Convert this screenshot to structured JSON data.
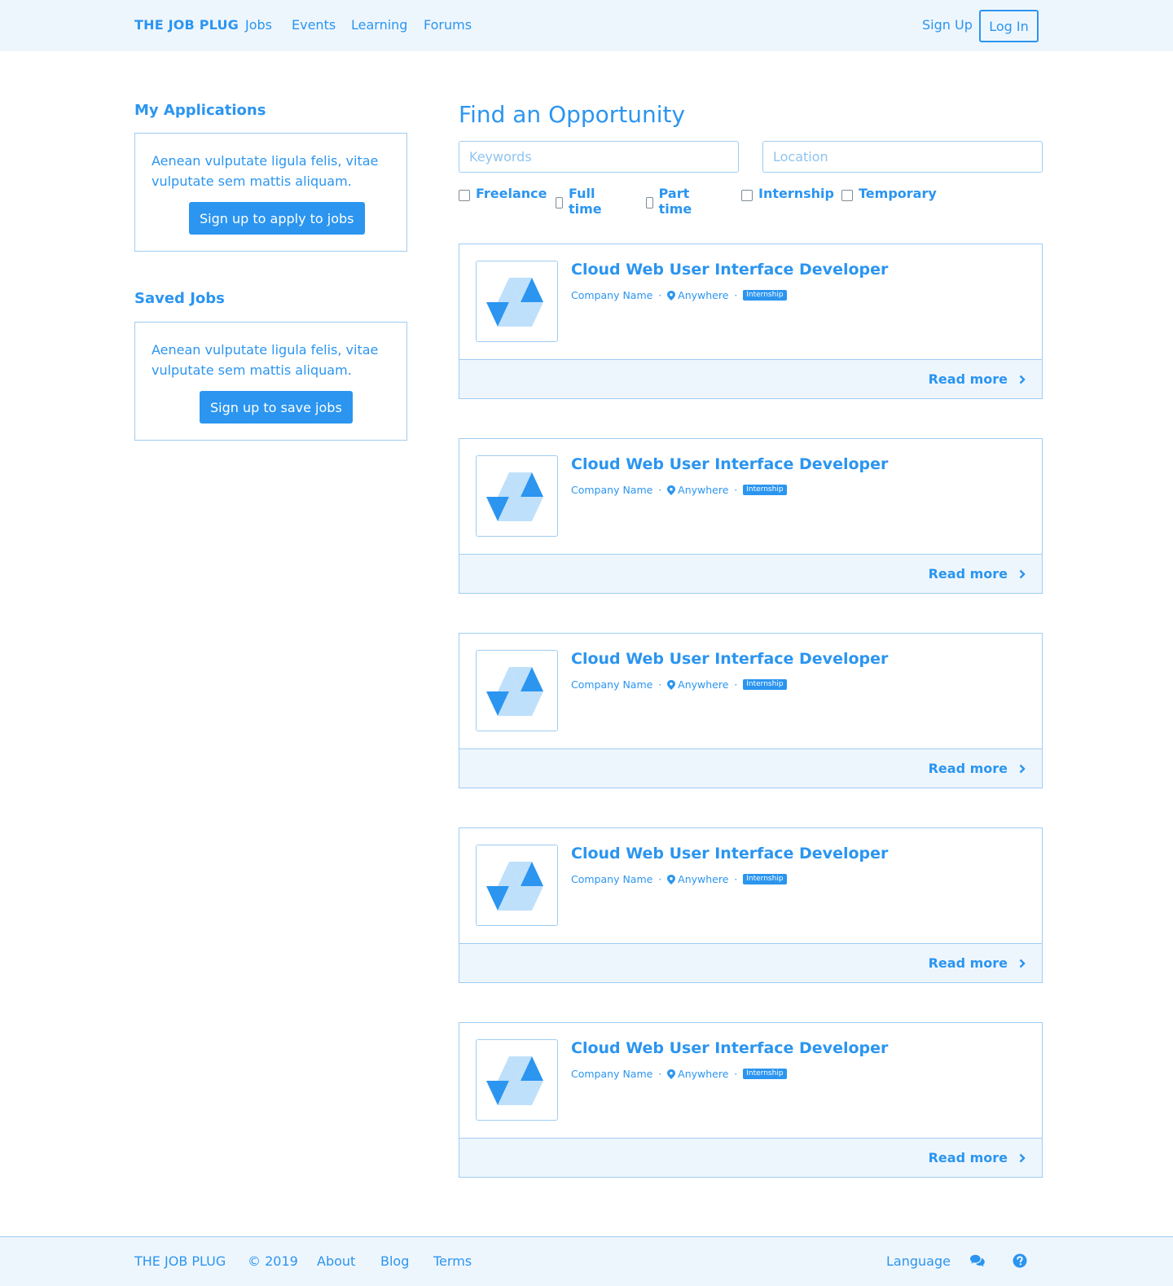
{
  "nav": {
    "brand": "THE JOB PLUG",
    "links": [
      "Jobs",
      "Events",
      "Learning",
      "Forums"
    ],
    "signup": "Sign Up",
    "login": "Log In"
  },
  "sidebar": {
    "applications": {
      "title": "My Applications",
      "text": "Aenean vulputate ligula felis, vitae vulputate sem mattis aliquam.",
      "button": "Sign up to apply to jobs"
    },
    "saved": {
      "title": "Saved Jobs",
      "text": "Aenean vulputate ligula felis, vitae vulputate sem mattis aliquam.",
      "button": "Sign up to save jobs"
    }
  },
  "main": {
    "title": "Find an Opportunity",
    "search": {
      "keywords_placeholder": "Keywords",
      "keywords_value": "",
      "location_placeholder": "Location",
      "location_value": ""
    },
    "filters": [
      {
        "label": "Freelance",
        "checked": false
      },
      {
        "label": "Full time",
        "checked": false
      },
      {
        "label": "Part time",
        "checked": false
      },
      {
        "label": "Internship",
        "checked": false
      },
      {
        "label": "Temporary",
        "checked": false
      }
    ],
    "jobs": [
      {
        "title": "Cloud Web User Interface Developer",
        "company": "Company Name",
        "location": "Anywhere",
        "type": "Internship",
        "link": "Read more"
      },
      {
        "title": "Cloud Web User Interface Developer",
        "company": "Company Name",
        "location": "Anywhere",
        "type": "Internship",
        "link": "Read more"
      },
      {
        "title": "Cloud Web User Interface Developer",
        "company": "Company Name",
        "location": "Anywhere",
        "type": "Internship",
        "link": "Read more"
      },
      {
        "title": "Cloud Web User Interface Developer",
        "company": "Company Name",
        "location": "Anywhere",
        "type": "Internship",
        "link": "Read more"
      },
      {
        "title": "Cloud Web User Interface Developer",
        "company": "Company Name",
        "location": "Anywhere",
        "type": "Internship",
        "link": "Read more"
      }
    ]
  },
  "footer": {
    "brand": "THE JOB PLUG",
    "copyright": "© 2019",
    "links": [
      "About",
      "Blog",
      "Terms"
    ],
    "language": "Language",
    "icons": [
      "chat-icon",
      "help-icon"
    ]
  },
  "colors": {
    "accent": "#2b95f0",
    "border": "#9fcdf3",
    "panel": "#eef6fd",
    "logo_light": "#bfe0fb"
  }
}
